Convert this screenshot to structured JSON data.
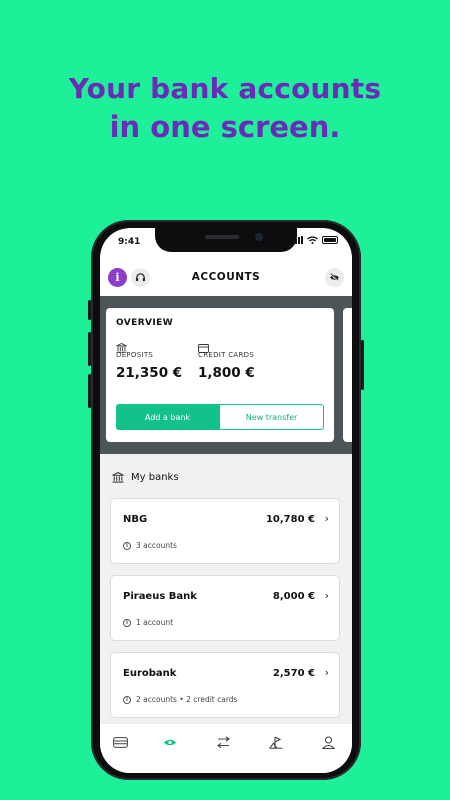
{
  "headline": {
    "line1": "Your bank accounts",
    "line2": "in one screen."
  },
  "status": {
    "time": "9:41"
  },
  "appbar": {
    "info_label": "i",
    "title": "ACCOUNTS"
  },
  "overview": {
    "title": "OVERVIEW",
    "deposits_label": "DEPOSITS",
    "deposits_value": "21,350 €",
    "credit_label": "CREDIT CARDS",
    "credit_value": "1,800 €",
    "add_bank_label": "Add a bank",
    "new_transfer_label": "New transfer"
  },
  "banks": {
    "header": "My banks",
    "items": [
      {
        "name": "NBG",
        "amount": "10,780 €",
        "subtitle": "3 accounts"
      },
      {
        "name": "Piraeus Bank",
        "amount": "8,000 €",
        "subtitle": "1 account"
      },
      {
        "name": "Eurobank",
        "amount": "2,570 €",
        "subtitle": "2 accounts • 2 credit cards"
      }
    ]
  },
  "tabs": [
    {
      "icon": "wallet-icon",
      "active": false
    },
    {
      "icon": "eye-icon",
      "active": true
    },
    {
      "icon": "transfer-icon",
      "active": false
    },
    {
      "icon": "flag-icon",
      "active": false
    },
    {
      "icon": "profile-icon",
      "active": false
    }
  ],
  "colors": {
    "background": "#1ef09a",
    "headline": "#6a2bb8",
    "accent": "#12c28a",
    "purple": "#8b3fc8",
    "band": "#4c5659"
  }
}
